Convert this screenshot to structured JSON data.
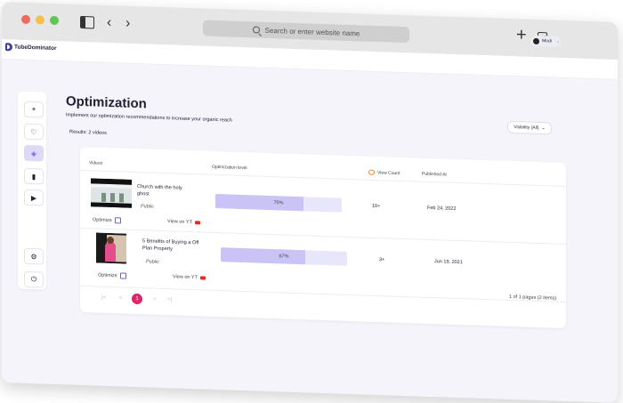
{
  "browser": {
    "address_placeholder": "Search or enter website name"
  },
  "app": {
    "name": "TubeDominator",
    "user_name": "Modi"
  },
  "page": {
    "title": "Optimization",
    "subtitle": "Implement our optimization recommendations to increase your organic reach",
    "results": "Results: 2 videos",
    "visibility_label": "Visibility (All)"
  },
  "table": {
    "headers": {
      "videos": "Videos",
      "optimization": "Optimization level",
      "views": "View Count",
      "published": "Published At"
    },
    "rows": [
      {
        "title": "Church with the holy ghost",
        "status": "Public",
        "optimization_pct": 70,
        "optimization_label": "70%",
        "views": "10+",
        "published": "Feb 24, 2022",
        "optimize": "Optimize",
        "view_on": "View on YT"
      },
      {
        "title": "5 Benefits of Buying a Off Plan Property",
        "status": "Public",
        "optimization_pct": 67,
        "optimization_label": "67%",
        "views": "3+",
        "published": "Jun 19, 2021",
        "optimize": "Optimize",
        "view_on": "View on YT"
      }
    ]
  },
  "pagination": {
    "first": "|<",
    "prev": "<",
    "current": "1",
    "next": ">",
    "last": ">|",
    "info": "1 of 1 pages (2 items)"
  },
  "colors": {
    "accent": "#6d5fe0",
    "page_active": "#e0246b",
    "bar_fill": "#c9c4f5",
    "bar_track": "#e8e6fb"
  }
}
